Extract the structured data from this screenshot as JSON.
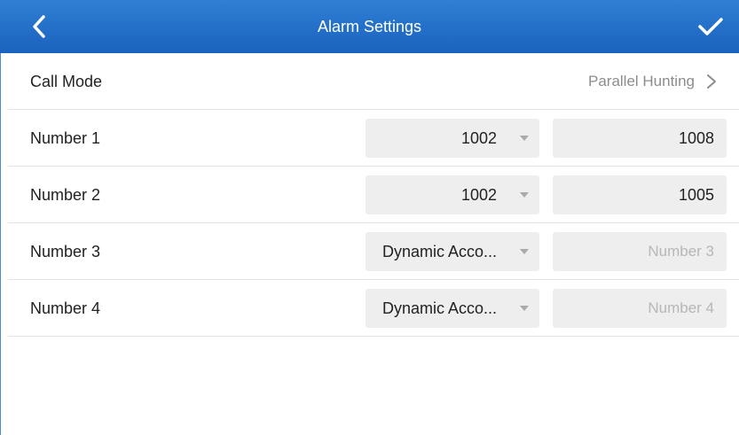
{
  "header": {
    "title": "Alarm Settings",
    "back_icon": "chevron-left-icon",
    "confirm_icon": "check-icon",
    "color": "#1f6cc8"
  },
  "call_mode": {
    "label": "Call Mode",
    "value": "Parallel Hunting"
  },
  "numbers": [
    {
      "label": "Number 1",
      "account": "1002",
      "number": "1008",
      "placeholder": ""
    },
    {
      "label": "Number 2",
      "account": "1002",
      "number": "1005",
      "placeholder": ""
    },
    {
      "label": "Number 3",
      "account": "Dynamic Acco...",
      "number": "",
      "placeholder": "Number 3"
    },
    {
      "label": "Number 4",
      "account": "Dynamic Acco...",
      "number": "",
      "placeholder": "Number 4"
    }
  ]
}
